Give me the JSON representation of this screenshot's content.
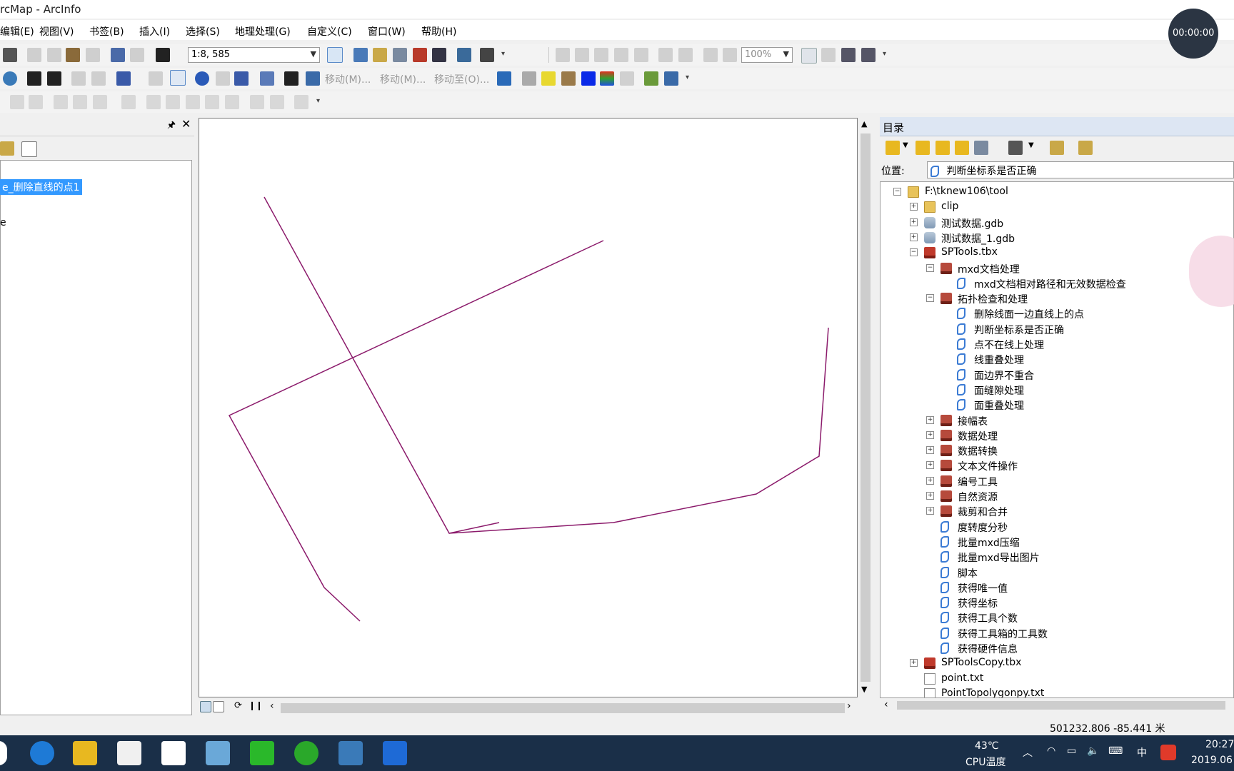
{
  "window": {
    "title": "rcMap - ArcInfo"
  },
  "menu": [
    "编辑(E)",
    "视图(V)",
    "书签(B)",
    "插入(I)",
    "选择(S)",
    "地理处理(G)",
    "自定义(C)",
    "窗口(W)",
    "帮助(H)"
  ],
  "toolbar": {
    "scale_value": "1:8, 585",
    "zoom_value": "100%",
    "move_label_1": "移动(M)...",
    "move_label_2": "移动(M)...",
    "move_to_label": "移动至(O)..."
  },
  "toc": {
    "selected_layer": "e_删除直线的点1",
    "second_item": "e"
  },
  "catalog": {
    "title": "目录",
    "location_label": "位置:",
    "location_value": "判断坐标系是否正确",
    "tree": [
      {
        "label": "F:\\tknew106\\tool",
        "icon": "folder-icon",
        "level": 0,
        "toggle": "minus"
      },
      {
        "label": "clip",
        "icon": "folder-icon",
        "level": 1,
        "toggle": "plus"
      },
      {
        "label": "测试数据.gdb",
        "icon": "database-icon",
        "level": 1,
        "toggle": "plus"
      },
      {
        "label": "测试数据_1.gdb",
        "icon": "database-icon",
        "level": 1,
        "toggle": "plus"
      },
      {
        "label": "SPTools.tbx",
        "icon": "toolbox-icon",
        "level": 1,
        "toggle": "minus"
      },
      {
        "label": "mxd文档处理",
        "icon": "toolset-icon",
        "level": 2,
        "toggle": "minus"
      },
      {
        "label": "mxd文档相对路径和无效数据检查",
        "icon": "script-icon",
        "level": 3,
        "toggle": ""
      },
      {
        "label": "拓扑检查和处理",
        "icon": "toolset-icon",
        "level": 2,
        "toggle": "minus"
      },
      {
        "label": "删除线面一边直线上的点",
        "icon": "script-icon",
        "level": 3,
        "toggle": ""
      },
      {
        "label": "判断坐标系是否正确",
        "icon": "script-icon",
        "level": 3,
        "toggle": ""
      },
      {
        "label": "点不在线上处理",
        "icon": "script-icon",
        "level": 3,
        "toggle": ""
      },
      {
        "label": "线重叠处理",
        "icon": "script-icon",
        "level": 3,
        "toggle": ""
      },
      {
        "label": "面边界不重合",
        "icon": "script-icon",
        "level": 3,
        "toggle": ""
      },
      {
        "label": "面缝隙处理",
        "icon": "script-icon",
        "level": 3,
        "toggle": ""
      },
      {
        "label": "面重叠处理",
        "icon": "script-icon",
        "level": 3,
        "toggle": ""
      },
      {
        "label": "接幅表",
        "icon": "toolset-icon",
        "level": 2,
        "toggle": "plus"
      },
      {
        "label": "数据处理",
        "icon": "toolset-icon",
        "level": 2,
        "toggle": "plus"
      },
      {
        "label": "数据转换",
        "icon": "toolset-icon",
        "level": 2,
        "toggle": "plus"
      },
      {
        "label": "文本文件操作",
        "icon": "toolset-icon",
        "level": 2,
        "toggle": "plus"
      },
      {
        "label": "编号工具",
        "icon": "toolset-icon",
        "level": 2,
        "toggle": "plus"
      },
      {
        "label": "自然资源",
        "icon": "toolset-icon",
        "level": 2,
        "toggle": "plus"
      },
      {
        "label": "裁剪和合并",
        "icon": "toolset-icon",
        "level": 2,
        "toggle": "plus"
      },
      {
        "label": "度转度分秒",
        "icon": "script-icon",
        "level": 2,
        "toggle": ""
      },
      {
        "label": "批量mxd压缩",
        "icon": "script-icon",
        "level": 2,
        "toggle": ""
      },
      {
        "label": "批量mxd导出图片",
        "icon": "script-icon",
        "level": 2,
        "toggle": ""
      },
      {
        "label": "脚本",
        "icon": "script-icon",
        "level": 2,
        "toggle": ""
      },
      {
        "label": "获得唯一值",
        "icon": "script-icon",
        "level": 2,
        "toggle": ""
      },
      {
        "label": "获得坐标",
        "icon": "script-icon",
        "level": 2,
        "toggle": ""
      },
      {
        "label": "获得工具个数",
        "icon": "script-icon",
        "level": 2,
        "toggle": ""
      },
      {
        "label": "获得工具箱的工具数",
        "icon": "script-icon",
        "level": 2,
        "toggle": ""
      },
      {
        "label": "获得硬件信息",
        "icon": "script-icon",
        "level": 2,
        "toggle": ""
      },
      {
        "label": "SPToolsCopy.tbx",
        "icon": "toolbox-icon",
        "level": 1,
        "toggle": "plus"
      },
      {
        "label": "point.txt",
        "icon": "file-icon",
        "level": 1,
        "toggle": ""
      },
      {
        "label": "PointTopolygonpy.txt",
        "icon": "file-icon",
        "level": 1,
        "toggle": ""
      }
    ]
  },
  "status": {
    "coords": "501232.806  -85.441 米"
  },
  "recorder": {
    "time": "00:00:00"
  },
  "taskbar": {
    "temperature": "43℃",
    "cpu_label": "CPU温度",
    "ime": "中",
    "clock_time": "20:27",
    "clock_date": "2019.06"
  },
  "colors": {
    "polyline": "#8b1a6b",
    "selection": "#3399ff",
    "catalog_header": "#dde6f3",
    "taskbar": "#1a2f48"
  }
}
